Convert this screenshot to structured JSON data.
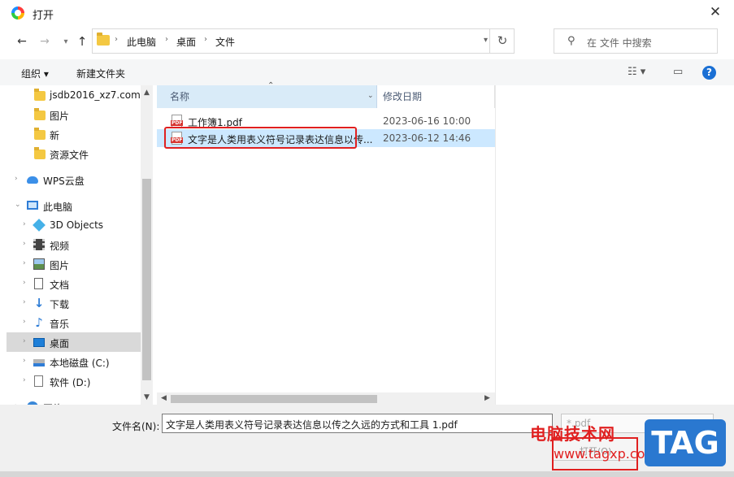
{
  "window": {
    "title": "打开",
    "close_glyph": "✕"
  },
  "address": {
    "crumbs": [
      "此电脑",
      "桌面",
      "文件"
    ],
    "search_placeholder": "在 文件 中搜索"
  },
  "toolbar": {
    "organize": "组织 ▾",
    "new_folder": "新建文件夹",
    "help": "?"
  },
  "sidebar": {
    "items": [
      {
        "label": "jsdb2016_xz7.com",
        "icon": "folder-icon"
      },
      {
        "label": "图片",
        "icon": "folder-icon"
      },
      {
        "label": "新",
        "icon": "folder-icon"
      },
      {
        "label": "资源文件",
        "icon": "folder-icon"
      },
      {
        "label": "WPS云盘",
        "icon": "cloud-icon"
      },
      {
        "label": "此电脑",
        "icon": "computer-icon"
      },
      {
        "label": "3D Objects",
        "icon": "cube-icon"
      },
      {
        "label": "视频",
        "icon": "video-icon"
      },
      {
        "label": "图片",
        "icon": "picture-icon"
      },
      {
        "label": "文档",
        "icon": "document-icon"
      },
      {
        "label": "下载",
        "icon": "download-icon"
      },
      {
        "label": "音乐",
        "icon": "music-icon"
      },
      {
        "label": "桌面",
        "icon": "desktop-icon",
        "selected": true
      },
      {
        "label": "本地磁盘 (C:)",
        "icon": "disk-icon"
      },
      {
        "label": "软件 (D:)",
        "icon": "drive-icon"
      },
      {
        "label": "网络",
        "icon": "network-icon"
      }
    ]
  },
  "columns": {
    "name": "名称",
    "modified": "修改日期"
  },
  "files": [
    {
      "name": "工作簿1.pdf",
      "modified": "2023-06-16 10:00",
      "selected": false
    },
    {
      "name": "文字是人类用表义符号记录表达信息以传...",
      "modified": "2023-06-12 14:46",
      "selected": true
    }
  ],
  "bottom": {
    "filename_label": "文件名(N):",
    "filename_value": "文字是人类用表义符号记录表达信息以传之久远的方式和工具 1.pdf",
    "filetype_value": "*.pdf",
    "open_label": "打开(O)"
  },
  "watermark": {
    "brand": "电脑技术网",
    "url": "www.tagxp.com",
    "tag": "TAG"
  },
  "colors": {
    "selection": "#cce8ff",
    "highlight": "#e02020",
    "accent": "#1a6fd4"
  }
}
